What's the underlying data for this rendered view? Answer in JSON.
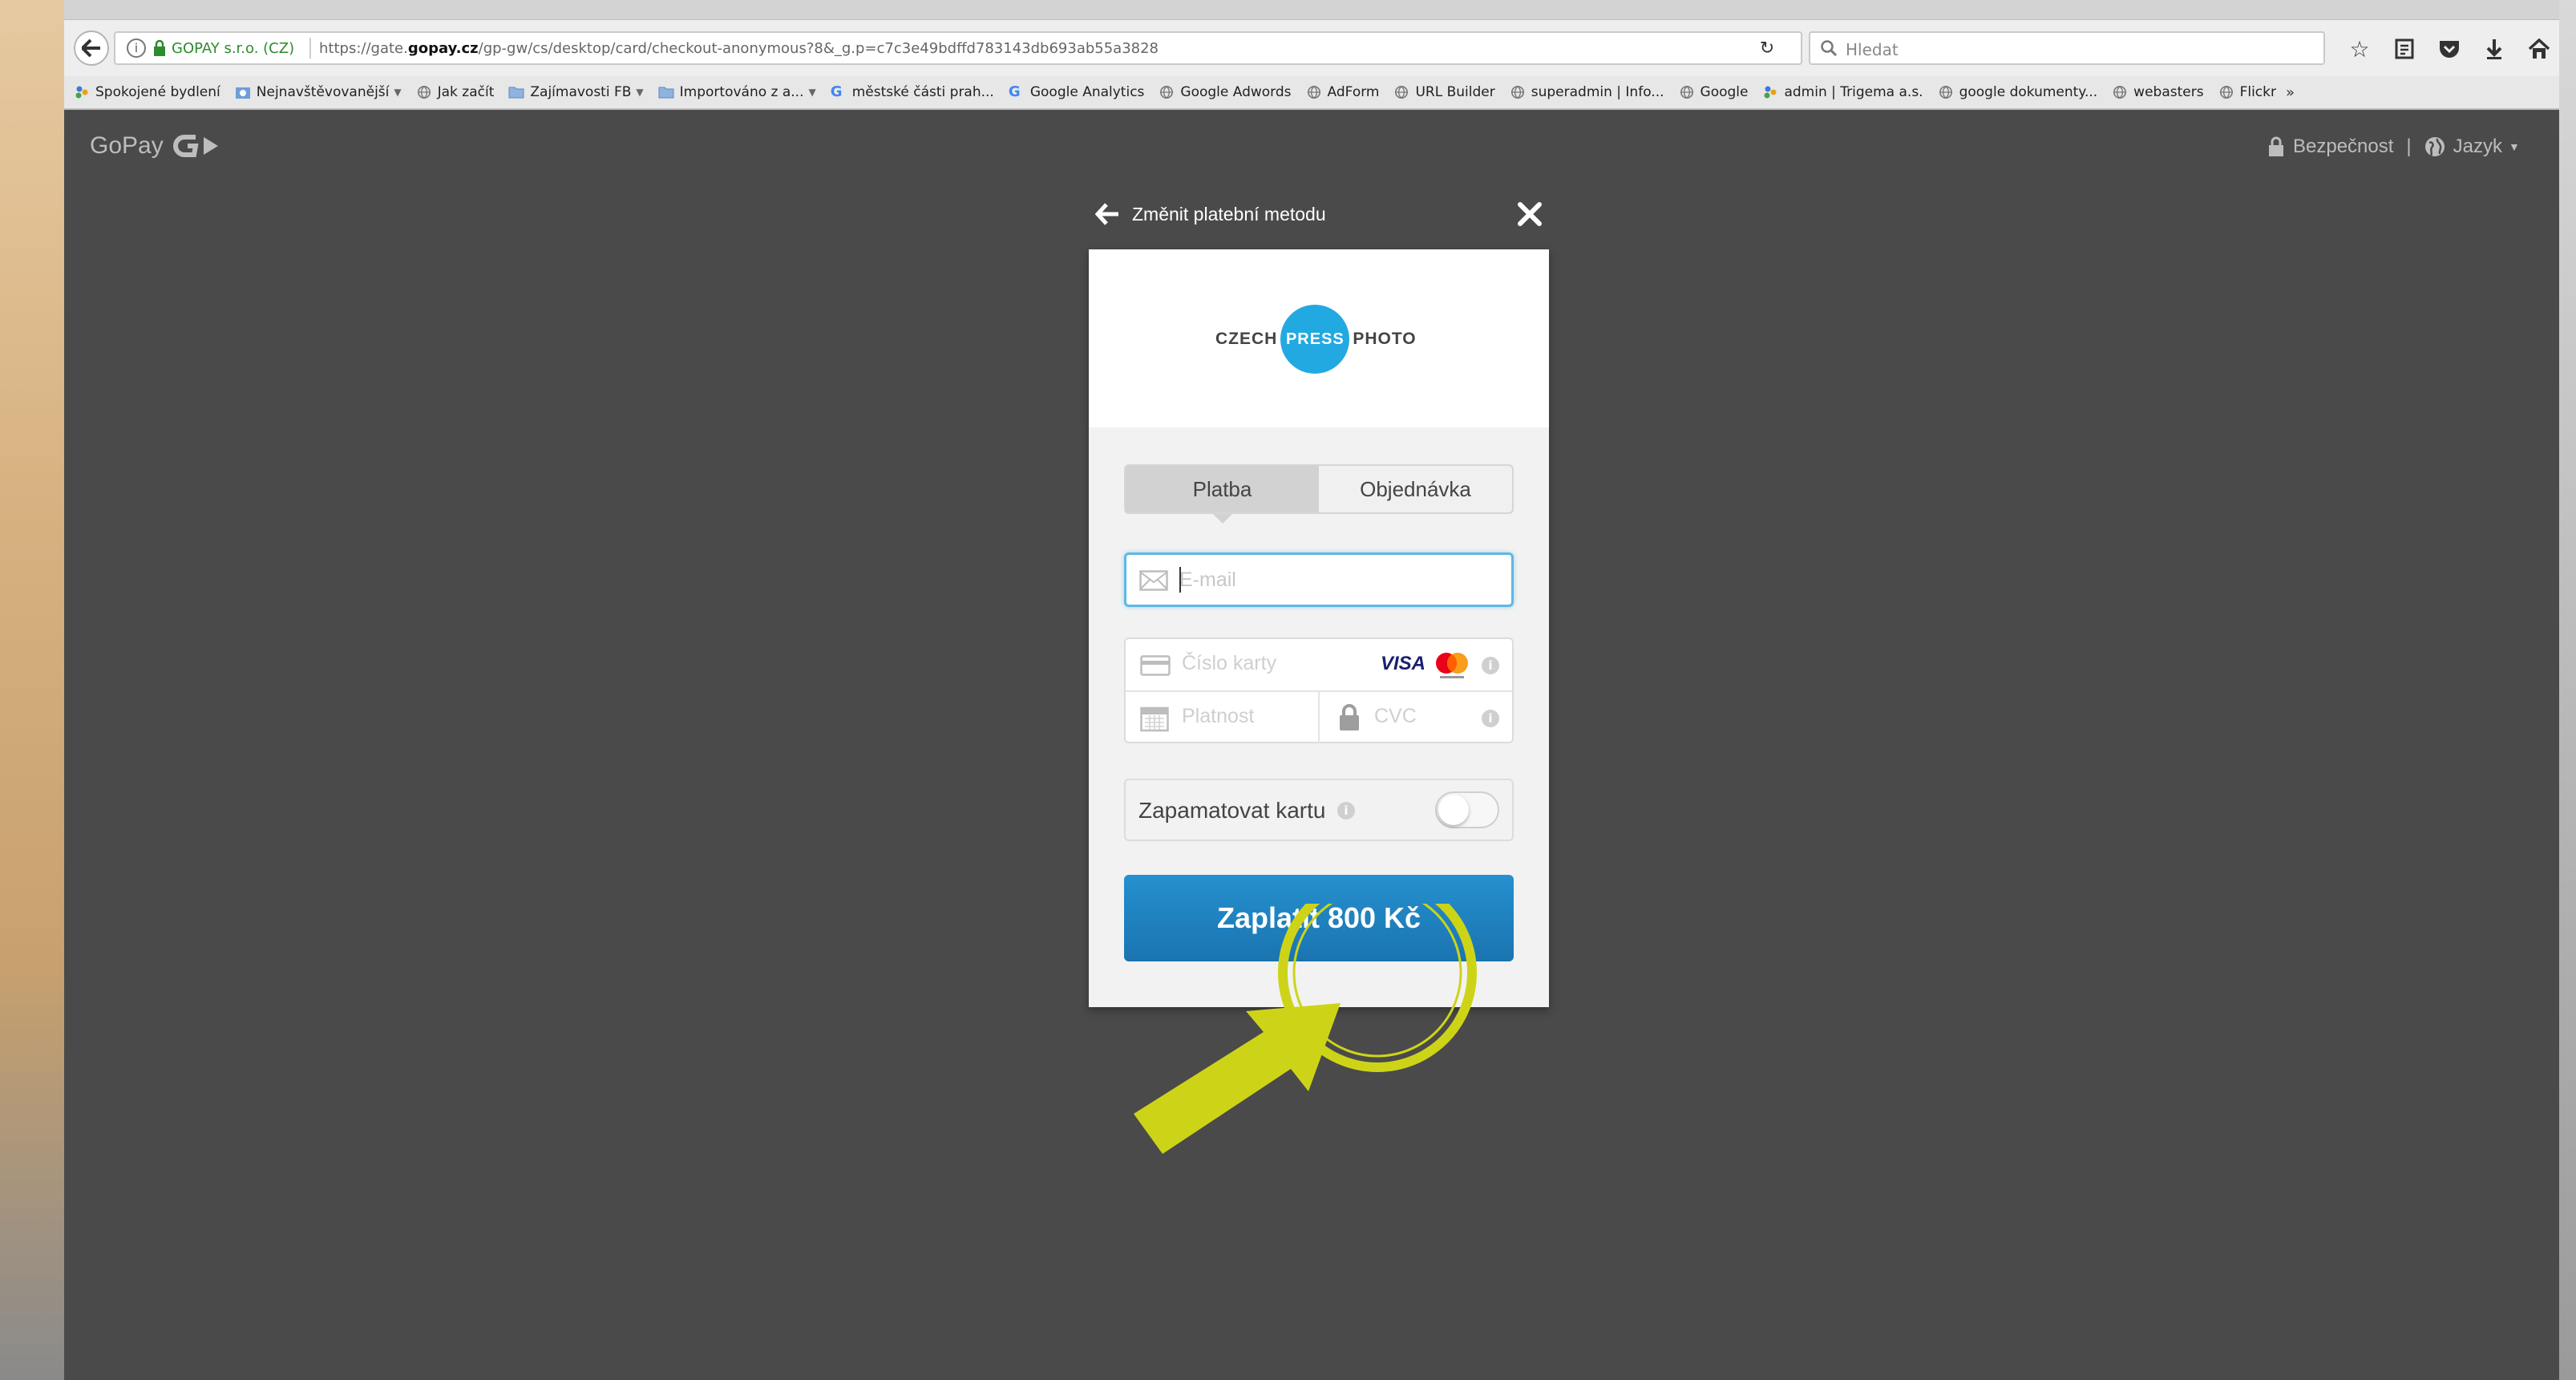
{
  "browser": {
    "url_company": "GOPAY s.r.o. (CZ)",
    "url_prefix": "https://gate.",
    "url_domain": "gopay.cz",
    "url_path": "/gp-gw/cs/desktop/card/checkout-anonymous?8&_g.p=c7c3e49bdffd783143db693ab55a3828",
    "search_placeholder": "Hledat",
    "bookmarks": [
      {
        "label": "Spokojené bydlení",
        "icon": "people-icon"
      },
      {
        "label": "Nejnavštěvovanější",
        "icon": "camera-folder-icon",
        "dropdown": true
      },
      {
        "label": "Jak začít",
        "icon": "globe-icon"
      },
      {
        "label": "Zajímavosti FB",
        "icon": "folder-icon",
        "dropdown": true
      },
      {
        "label": "Importováno z a...",
        "icon": "folder-icon",
        "dropdown": true
      },
      {
        "label": "městské části prah...",
        "icon": "google-icon"
      },
      {
        "label": "Google Analytics",
        "icon": "google-icon"
      },
      {
        "label": "Google Adwords",
        "icon": "globe-icon"
      },
      {
        "label": "AdForm",
        "icon": "globe-icon"
      },
      {
        "label": "URL Builder",
        "icon": "globe-icon"
      },
      {
        "label": "superadmin | Info...",
        "icon": "globe-icon"
      },
      {
        "label": "Google",
        "icon": "globe-icon"
      },
      {
        "label": "admin | Trigema a.s.",
        "icon": "people-icon"
      },
      {
        "label": "google dokumenty...",
        "icon": "globe-icon"
      },
      {
        "label": "webasters",
        "icon": "globe-icon"
      },
      {
        "label": "Flickr",
        "icon": "globe-icon"
      }
    ],
    "bookmarks_more": "»"
  },
  "page": {
    "brand": "GoPay",
    "security_label": "Bezpečnost",
    "separator": "|",
    "language_label": "Jazyk",
    "change_method_label": "Změnit platební metodu"
  },
  "merchant": {
    "word1": "CZECH",
    "word2": "PRESS",
    "word3": "PHOTO"
  },
  "tabs": {
    "payment": "Platba",
    "order": "Objednávka"
  },
  "form": {
    "email_placeholder": "E-mail",
    "card_number_placeholder": "Číslo karty",
    "card_brand": "VISA",
    "expiry_placeholder": "Platnost",
    "cvc_placeholder": "CVC",
    "remember_label": "Zapamatovat kartu",
    "remember_on": false,
    "pay_button": "Zaplatit 800 Kč"
  },
  "colors": {
    "accent_blue": "#1f82c0",
    "press_blue": "#22a9e1",
    "annotation": "#cdd418"
  }
}
